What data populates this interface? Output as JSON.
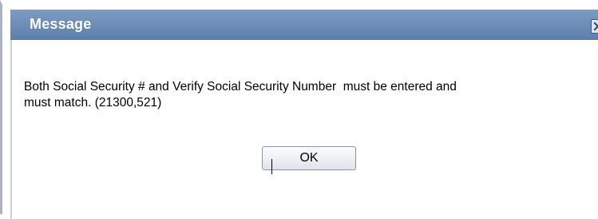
{
  "dialog": {
    "title": "Message",
    "close_icon": "close-icon",
    "message": "Both Social Security # and Verify Social Security Number  must be entered and\nmust match. (21300,521)",
    "ok_label": "OK"
  },
  "colors": {
    "titlebar": "#6f8fb8",
    "title_text": "#ffffff",
    "close_border": "#3f5f8a",
    "button_border": "#8a96a6"
  }
}
